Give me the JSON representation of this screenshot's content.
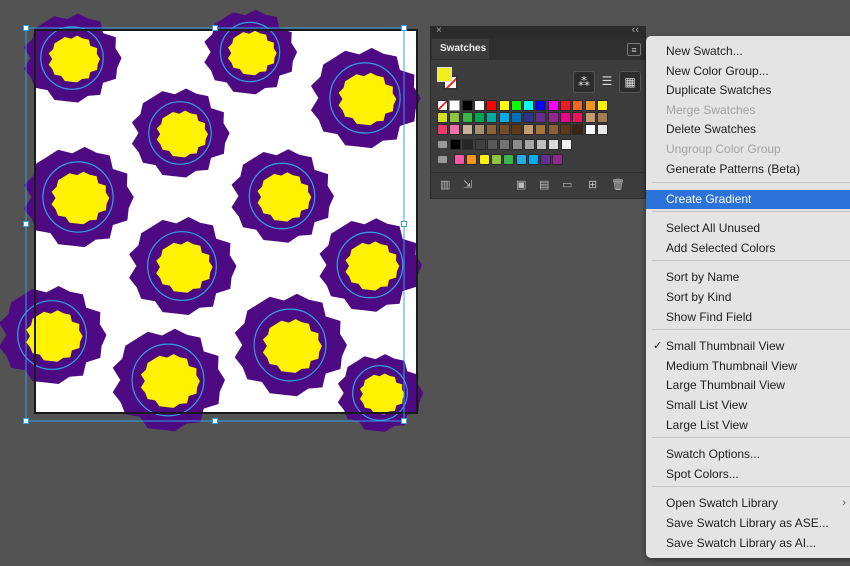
{
  "panel": {
    "title": "Swatches",
    "close_glyph": "×",
    "collapse_glyph": "‹‹",
    "menu_glyph": "≡",
    "fill_color": "#f4ef1c",
    "stroke_color": "none",
    "rows": [
      [
        "none",
        "registration",
        "#000000",
        "#ffffff",
        "#ff0000",
        "#ffff00",
        "#00ff00",
        "#00ffff",
        "#0000ff",
        "#ff00ff",
        "#ed1c24",
        "#f26522",
        "#f7941d",
        "#fff200"
      ],
      [
        "#d7df23",
        "#8dc63f",
        "#39b54a",
        "#00a651",
        "#00a99d",
        "#00aeef",
        "#0072bc",
        "#2e3192",
        "#662d91",
        "#92278f",
        "#ec008c",
        "#ed145b",
        "#c69c6d",
        "#a67c52"
      ],
      [
        "#ec3a6b",
        "#f06eaa",
        "#c7b299",
        "#a68f6c",
        "#8c6239",
        "#754c24",
        "#603913",
        "#c49a6c",
        "#a7753a",
        "#8b5e3c",
        "#603813",
        "#3c2415",
        "#fdfdfd",
        "#e8e8e8"
      ],
      [
        "#000000",
        "#262626",
        "#404040",
        "#595959",
        "#737373",
        "#8c8c8c",
        "#a6a6a6",
        "#bfbfbf",
        "#d9d9d9",
        "#f2f2f2"
      ],
      [
        "#f05aa6",
        "#f7941d",
        "#fff200",
        "#8dc63f",
        "#39b54a",
        "#29abe2",
        "#00aeef",
        "#662d91",
        "#92278f"
      ]
    ]
  },
  "menu": {
    "items": [
      {
        "label": "New Swatch...",
        "state": "normal"
      },
      {
        "label": "New Color Group...",
        "state": "normal"
      },
      {
        "label": "Duplicate Swatches",
        "state": "normal"
      },
      {
        "label": "Merge Swatches",
        "state": "disabled"
      },
      {
        "label": "Delete Swatches",
        "state": "normal"
      },
      {
        "label": "Ungroup Color Group",
        "state": "disabled"
      },
      {
        "label": "Generate Patterns (Beta)",
        "state": "normal"
      },
      {
        "label": "Create Gradient",
        "state": "highlighted"
      },
      {
        "label": "Select All Unused",
        "state": "normal"
      },
      {
        "label": "Add Selected Colors",
        "state": "normal"
      },
      {
        "label": "Sort by Name",
        "state": "normal"
      },
      {
        "label": "Sort by Kind",
        "state": "normal"
      },
      {
        "label": "Show Find Field",
        "state": "normal"
      },
      {
        "label": "Small Thumbnail View",
        "state": "checked"
      },
      {
        "label": "Medium Thumbnail View",
        "state": "normal"
      },
      {
        "label": "Large Thumbnail View",
        "state": "normal"
      },
      {
        "label": "Small List View",
        "state": "normal"
      },
      {
        "label": "Large List View",
        "state": "normal"
      },
      {
        "label": "Swatch Options...",
        "state": "normal"
      },
      {
        "label": "Spot Colors...",
        "state": "normal"
      },
      {
        "label": "Open Swatch Library",
        "state": "submenu"
      },
      {
        "label": "Save Swatch Library as ASE...",
        "state": "normal"
      },
      {
        "label": "Save Swatch Library as AI...",
        "state": "normal"
      }
    ],
    "check_glyph": "✓",
    "submenu_glyph": "›"
  },
  "colors": {
    "canvas": "#535353",
    "spot_dark": "#4e0a82",
    "spot_light": "#fff200",
    "guide": "#2fa0e8",
    "menu_highlight": "#2c73d9"
  }
}
